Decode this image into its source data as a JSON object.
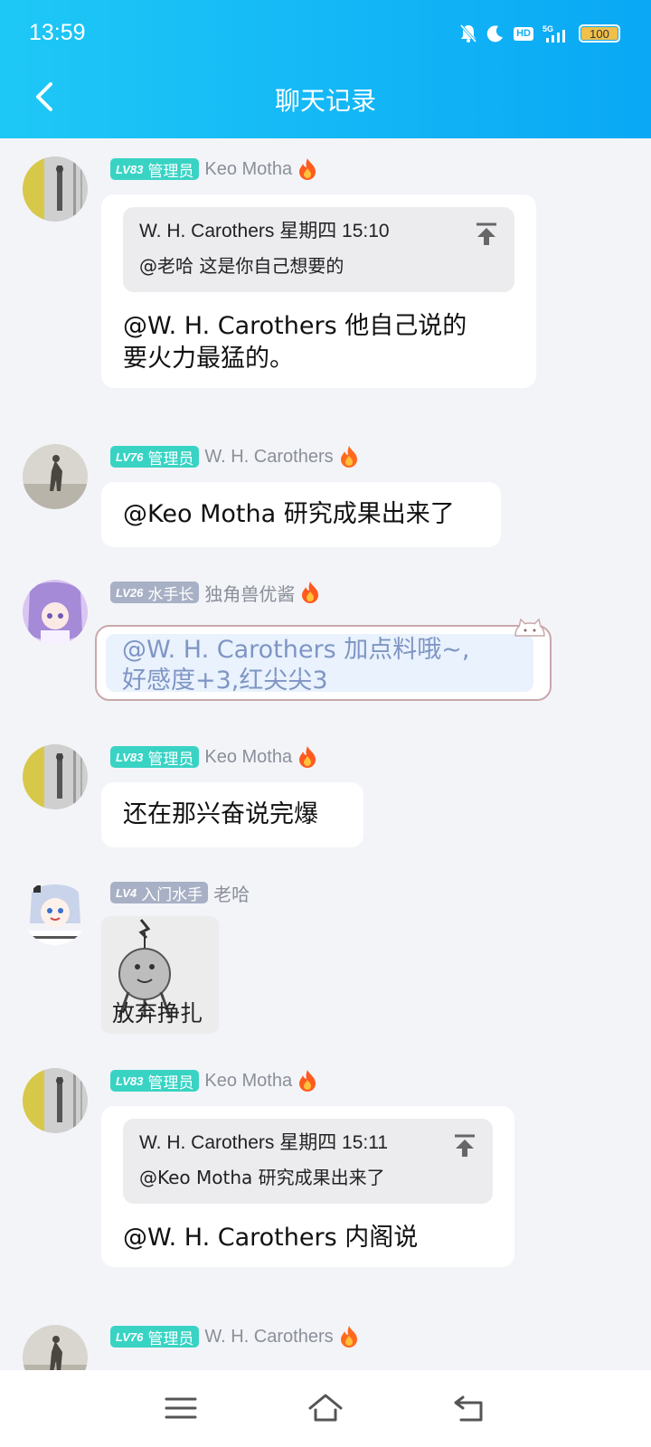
{
  "status_bar": {
    "time": "13:59",
    "network": "5G",
    "hd": "HD",
    "battery": "100"
  },
  "header": {
    "title": "聊天记录"
  },
  "messages": [
    {
      "level": "LV83",
      "role": "管理员",
      "sender": "Keo Motha",
      "quote": {
        "author_time": "W. H. Carothers 星期四 15:10",
        "text": "@老哈 这是你自己想要的"
      },
      "line1": "@W. H. Carothers 他自己说的",
      "line2": "要火力最猛的。"
    },
    {
      "level": "LV76",
      "role": "管理员",
      "sender": "W. H. Carothers",
      "text": "@Keo Motha 研究成果出来了"
    },
    {
      "level": "LV26",
      "role": "水手长",
      "sender": "独角兽优酱",
      "line1": "@W. H. Carothers 加点料哦~,",
      "line2": "好感度+3,红尖尖3"
    },
    {
      "level": "LV83",
      "role": "管理员",
      "sender": "Keo Motha",
      "text": "还在那兴奋说完爆"
    },
    {
      "level": "LV4",
      "role": "入门水手",
      "sender": "老哈",
      "sticker_text": "放弃挣扎"
    },
    {
      "level": "LV83",
      "role": "管理员",
      "sender": "Keo Motha",
      "quote": {
        "author_time": "W. H. Carothers 星期四 15:11",
        "text": "@Keo Motha 研究成果出来了"
      },
      "text": "@W. H. Carothers 内阁说"
    },
    {
      "level": "LV76",
      "role": "管理员",
      "sender": "W. H. Carothers"
    }
  ],
  "colors": {
    "header_start": "#1ec8f6",
    "header_end": "#0aa8f5",
    "badge_teal": "#39d3c4",
    "badge_gray": "#a8b0c5"
  },
  "icons": [
    "back-icon",
    "mute-bell-icon",
    "moon-icon",
    "signal-icon",
    "flame-icon",
    "pin-top-icon",
    "menu-icon",
    "home-icon",
    "back-nav-icon"
  ]
}
